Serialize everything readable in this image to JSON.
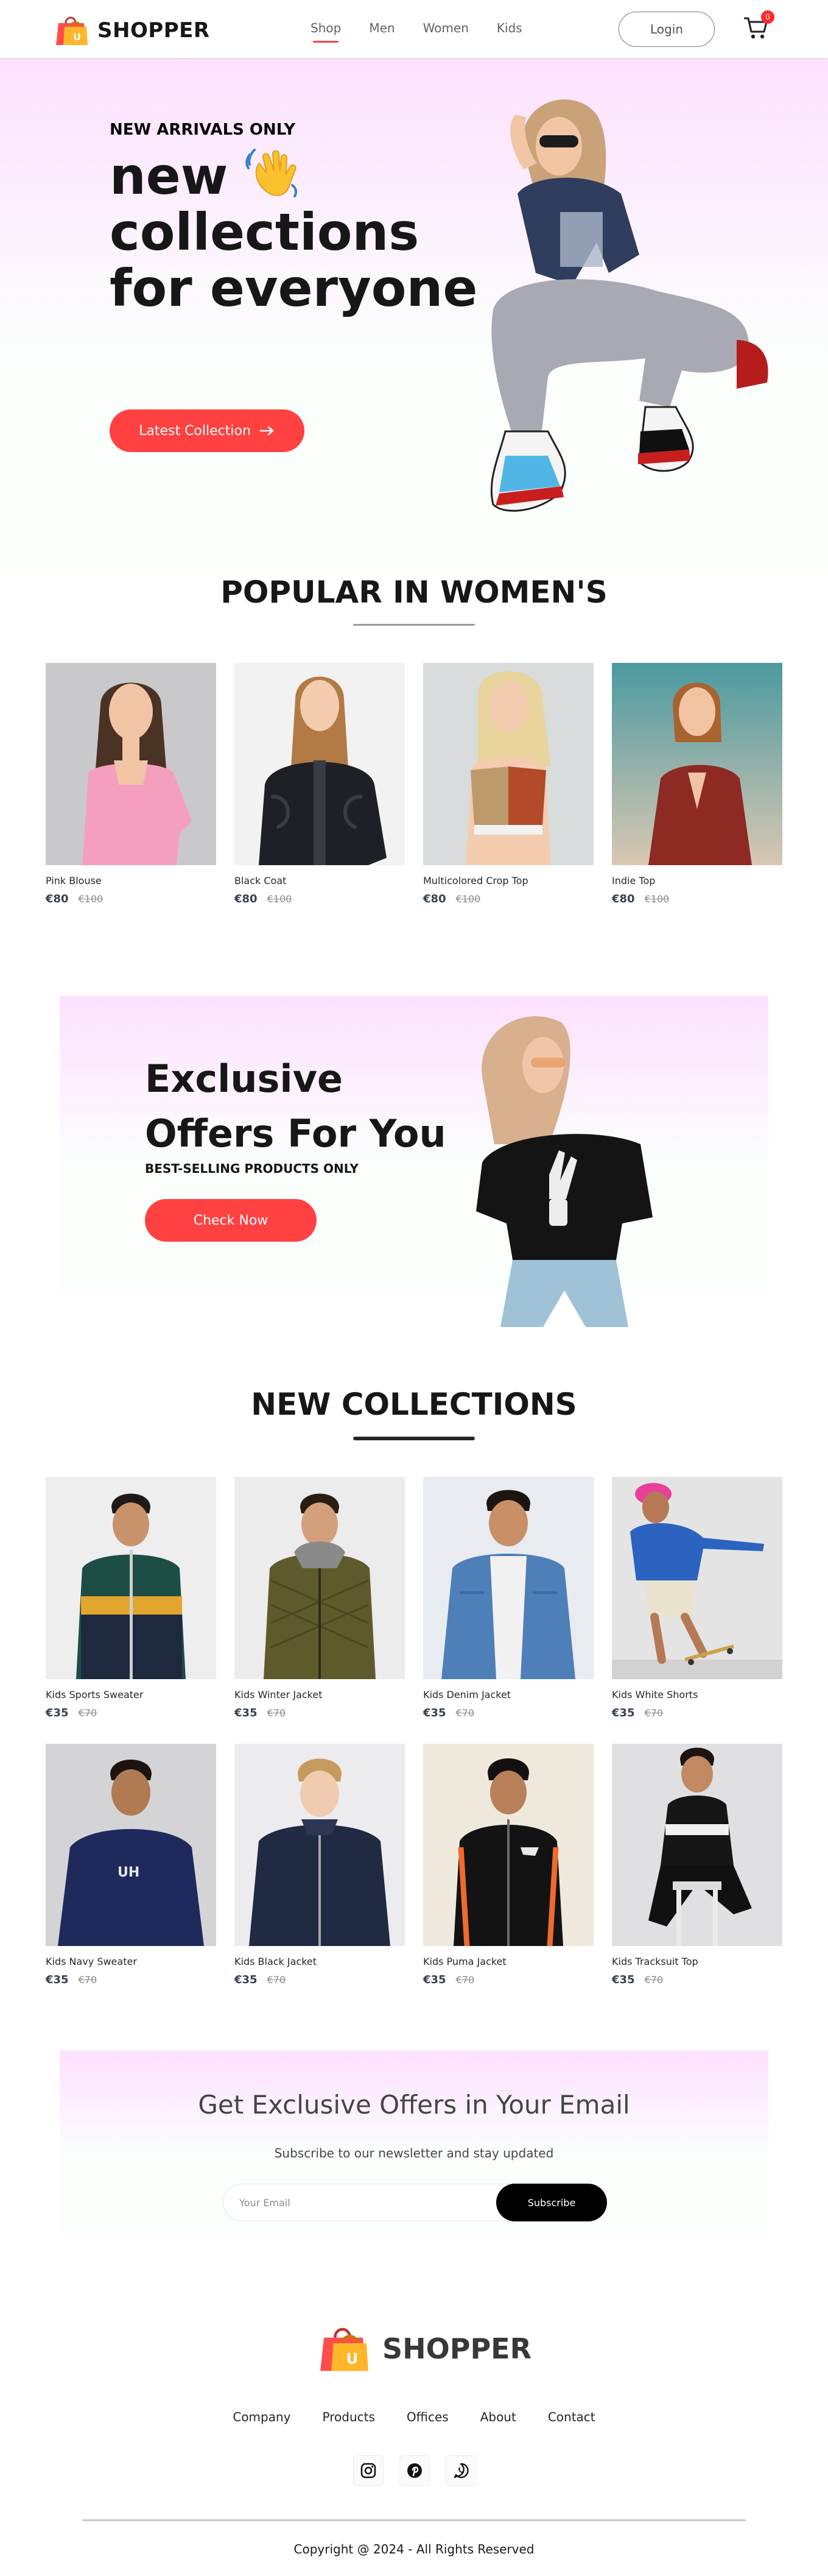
{
  "nav": {
    "brand": "SHOPPER",
    "menu": [
      "Shop",
      "Men",
      "Women",
      "Kids"
    ],
    "active": "Shop",
    "login_label": "Login",
    "cart_count": "0",
    "colors": {
      "active_underline": "#ff4141",
      "menu_text": "#626262"
    }
  },
  "hero": {
    "kicker": "NEW ARRIVALS ONLY",
    "title_line1": "new",
    "title_line2": "collections",
    "title_line3": "for everyone",
    "cta_label": "Latest Collection",
    "icons": [
      "waving-hand-icon",
      "arrow-right-icon"
    ]
  },
  "popular": {
    "title": "POPULAR IN WOMEN'S",
    "items": [
      {
        "name": "Pink Blouse",
        "new_price": "€80",
        "old_price": "€100"
      },
      {
        "name": "Black Coat",
        "new_price": "€80",
        "old_price": "€100"
      },
      {
        "name": "Multicolored Crop Top",
        "new_price": "€80",
        "old_price": "€100"
      },
      {
        "name": "Indie Top",
        "new_price": "€80",
        "old_price": "€100"
      }
    ]
  },
  "offers": {
    "title_line1": "Exclusive",
    "title_line2": "Offers For You",
    "subtitle": "BEST-SELLING PRODUCTS ONLY",
    "cta_label": "Check Now",
    "accent": "#ff4141"
  },
  "new_collections": {
    "title": "NEW COLLECTIONS",
    "items": [
      {
        "name": "Kids Sports Sweater",
        "new_price": "€35",
        "old_price": "€70"
      },
      {
        "name": "Kids Winter Jacket",
        "new_price": "€35",
        "old_price": "€70"
      },
      {
        "name": "Kids Denim Jacket",
        "new_price": "€35",
        "old_price": "€70"
      },
      {
        "name": "Kids White Shorts",
        "new_price": "€35",
        "old_price": "€70"
      },
      {
        "name": "Kids Navy Sweater",
        "new_price": "€35",
        "old_price": "€70"
      },
      {
        "name": "Kids Black Jacket",
        "new_price": "€35",
        "old_price": "€70"
      },
      {
        "name": "Kids Puma Jacket",
        "new_price": "€35",
        "old_price": "€70"
      },
      {
        "name": "Kids Tracksuit Top",
        "new_price": "€35",
        "old_price": "€70"
      }
    ]
  },
  "newsletter": {
    "title": "Get Exclusive Offers in Your Email",
    "subtitle": "Subscribe to our newsletter and stay updated",
    "placeholder": "Your Email",
    "button_label": "Subscribe"
  },
  "footer": {
    "brand": "SHOPPER",
    "links": [
      "Company",
      "Products",
      "Offices",
      "About",
      "Contact"
    ],
    "social_icons": [
      "instagram-icon",
      "pinterest-icon",
      "whatsapp-icon"
    ],
    "copyright": "Copyright @ 2024 - All Rights Reserved"
  }
}
